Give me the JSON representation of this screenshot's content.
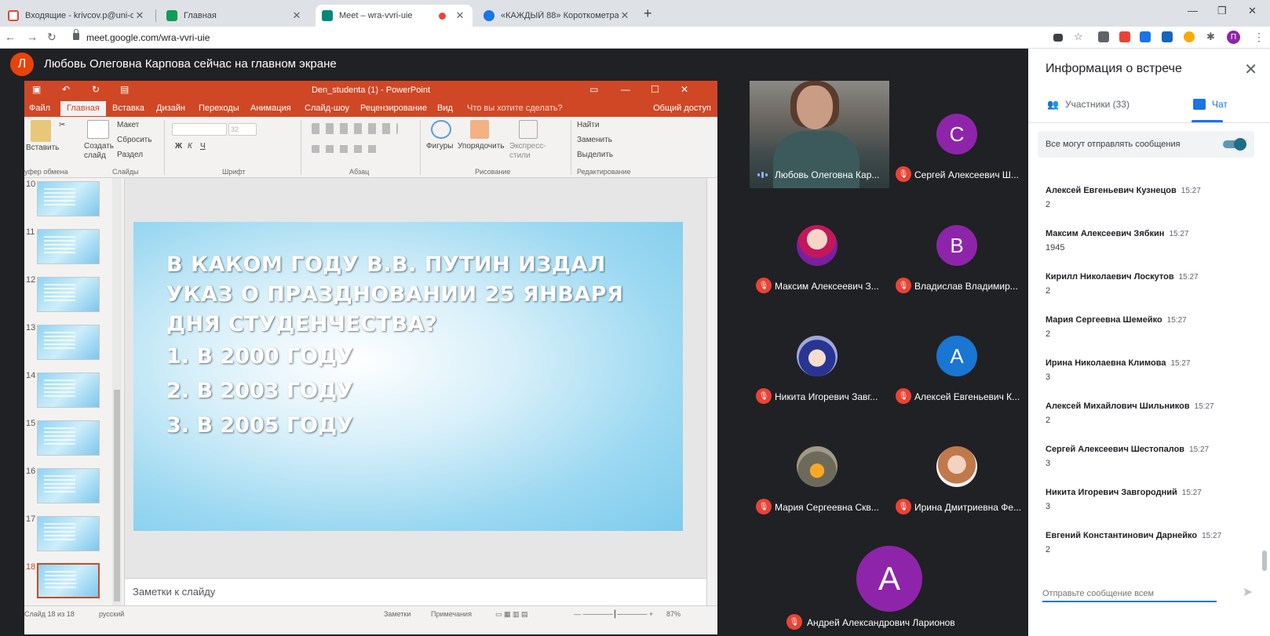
{
  "browser": {
    "tabs": [
      {
        "title": "Входящие - krivcov.p@uni-dubn",
        "favicon_color": "#ea4335"
      },
      {
        "title": "Главная",
        "favicon_color": "#0f9d58"
      },
      {
        "title": "Meet – wra-vvri-uie",
        "favicon_color": "#00897b"
      },
      {
        "title": "«КАЖДЫЙ 88» Короткометраж",
        "favicon_color": "#1a73e8"
      }
    ],
    "url": "meet.google.com/wra-vvri-uie",
    "profile_initial": "П"
  },
  "meet": {
    "presenter_initial": "Л",
    "presenter_text": "Любовь Олеговна Карпова сейчас на главном экране"
  },
  "ppt": {
    "title": "Den_studenta (1) - PowerPoint",
    "ribbon_tabs": [
      "Файл",
      "Главная",
      "Вставка",
      "Дизайн",
      "Переходы",
      "Анимация",
      "Слайд-шоу",
      "Рецензирование",
      "Вид"
    ],
    "tell_me": "Что вы хотите сделать?",
    "share": "Общий доступ",
    "ribbon": {
      "paste": "Вставить",
      "layout": "Макет",
      "reset": "Сбросить",
      "section": "Раздел",
      "new_slide": "Создать слайд",
      "font_size": "32",
      "shapes": "Фигуры",
      "arrange": "Упорядочить",
      "quick_styles": "Экспресс-стили",
      "find": "Найти",
      "replace": "Заменить",
      "select": "Выделить",
      "groups": [
        "уфер обмена",
        "Слайды",
        "Шрифт",
        "Абзац",
        "Рисование",
        "Редактирование"
      ]
    },
    "thumb_numbers": [
      "10",
      "11",
      "12",
      "13",
      "14",
      "15",
      "16",
      "17",
      "18"
    ],
    "slide": {
      "question": "В каком году В.В. Путин издал указ о праздновании 25 января Дня студенчества?",
      "options": [
        "1.  в 2000 году",
        "2.  в 2003 году",
        "3.  в 2005 году"
      ]
    },
    "notes_placeholder": "Заметки к слайду",
    "status": {
      "slide_counter": "Слайд 18 из 18",
      "language": "русский",
      "notes": "Заметки",
      "comments": "Примечания",
      "zoom": "87%"
    }
  },
  "participants": [
    {
      "name": "Любовь Олеговна Кар...",
      "avatar": "photo",
      "muted": false
    },
    {
      "name": "Сергей Алексеевич Ш...",
      "avatar": "letter",
      "initial": "С",
      "color": "#8e24aa",
      "muted": true
    },
    {
      "name": "Максим Алексеевич З...",
      "avatar": "picture",
      "muted": true
    },
    {
      "name": "Владислав Владимир...",
      "avatar": "letter",
      "initial": "В",
      "color": "#8e24aa",
      "muted": true
    },
    {
      "name": "Никита Игоревич Завг...",
      "avatar": "picture",
      "muted": true
    },
    {
      "name": "Алексей Евгеньевич К...",
      "avatar": "letter",
      "initial": "А",
      "color": "#1976d2",
      "muted": true
    },
    {
      "name": "Мария Сергеевна Скв...",
      "avatar": "picture",
      "muted": true
    },
    {
      "name": "Ирина Дмитриевна Фе...",
      "avatar": "picture",
      "muted": true
    },
    {
      "name": "Андрей Александрович Ларионов",
      "avatar": "letter",
      "initial": "А",
      "color": "#8e24aa",
      "muted": true
    }
  ],
  "panel": {
    "title": "Информация о встрече",
    "people_tab": "Участники (33)",
    "chat_tab": "Чат",
    "allow_label": "Все могут отправлять сообщения",
    "messages": [
      {
        "author": "Алексей Евгеньевич Кузнецов",
        "time": "15:27",
        "text": "2"
      },
      {
        "author": "Максим Алексеевич Зябкин",
        "time": "15:27",
        "text": "1945"
      },
      {
        "author": "Кирилл Николаевич Лоскутов",
        "time": "15:27",
        "text": "2"
      },
      {
        "author": "Мария Сергеевна Шемейко",
        "time": "15:27",
        "text": "2"
      },
      {
        "author": "Ирина Николаевна Климова",
        "time": "15:27",
        "text": "3"
      },
      {
        "author": "Алексей Михайлович Шильников",
        "time": "15:27",
        "text": "2"
      },
      {
        "author": "Сергей Алексеевич Шестопалов",
        "time": "15:27",
        "text": "3"
      },
      {
        "author": "Никита Игоревич Завгородний",
        "time": "15:27",
        "text": "3"
      },
      {
        "author": "Евгений Константинович Дарнейко",
        "time": "15:27",
        "text": "2"
      }
    ],
    "composer_placeholder": "Отправьте сообщение всем"
  }
}
